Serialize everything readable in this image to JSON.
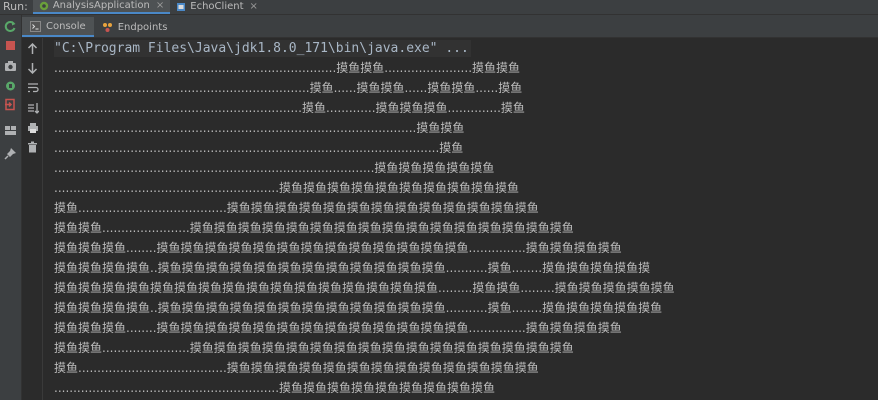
{
  "run_bar": {
    "label": "Run:",
    "tabs": [
      {
        "label": "AnalysisApplication",
        "active": true
      },
      {
        "label": "EchoClient",
        "active": false
      }
    ],
    "close_glyph": "×"
  },
  "console_tabs": [
    {
      "label": "Console",
      "icon": "console-icon",
      "active": true
    },
    {
      "label": "Endpoints",
      "icon": "endpoints-icon",
      "active": false
    }
  ],
  "left_toolbar": [
    "rerun-icon",
    "stop-icon",
    "camera-icon",
    "restart-debug-icon",
    "exit-icon",
    "layout-icon",
    "pin-icon"
  ],
  "console_toolbar": [
    "up-arrow-icon",
    "down-arrow-icon",
    "soft-wrap-icon",
    "sort-icon",
    "print-icon",
    "trash-icon"
  ],
  "colors": {
    "background": "#2b2b2b",
    "panel": "#3c3f41",
    "accent": "#4a88c7",
    "text": "#bbbbbb",
    "command_text": "#a9b7c6"
  },
  "console": {
    "command": "\"C:\\Program Files\\Java\\jdk1.8.0_171\\bin\\java.exe\" ...",
    "lines": [
      "..........................................................................摸鱼摸鱼.......................摸鱼摸鱼",
      "...................................................................摸鱼......摸鱼摸鱼......摸鱼摸鱼......摸鱼",
      ".................................................................摸鱼.............摸鱼摸鱼摸鱼..............摸鱼",
      "...............................................................................................摸鱼摸鱼",
      ".....................................................................................................摸鱼",
      "....................................................................................摸鱼摸鱼摸鱼摸鱼摸鱼",
      "...........................................................摸鱼摸鱼摸鱼摸鱼摸鱼摸鱼摸鱼摸鱼摸鱼摸鱼",
      "摸鱼.......................................摸鱼摸鱼摸鱼摸鱼摸鱼摸鱼摸鱼摸鱼摸鱼摸鱼摸鱼摸鱼摸鱼",
      "摸鱼摸鱼.......................摸鱼摸鱼摸鱼摸鱼摸鱼摸鱼摸鱼摸鱼摸鱼摸鱼摸鱼摸鱼摸鱼摸鱼摸鱼摸鱼",
      "摸鱼摸鱼摸鱼........摸鱼摸鱼摸鱼摸鱼摸鱼摸鱼摸鱼摸鱼摸鱼摸鱼摸鱼摸鱼摸鱼...............摸鱼摸鱼摸鱼摸鱼",
      "摸鱼摸鱼摸鱼摸鱼..摸鱼摸鱼摸鱼摸鱼摸鱼摸鱼摸鱼摸鱼摸鱼摸鱼摸鱼摸鱼...........摸鱼........摸鱼摸鱼摸鱼摸鱼摸",
      "摸鱼摸鱼摸鱼摸鱼摸鱼摸鱼摸鱼摸鱼摸鱼摸鱼摸鱼摸鱼摸鱼摸鱼摸鱼摸鱼.........摸鱼摸鱼.........摸鱼摸鱼摸鱼摸鱼摸鱼",
      "摸鱼摸鱼摸鱼摸鱼..摸鱼摸鱼摸鱼摸鱼摸鱼摸鱼摸鱼摸鱼摸鱼摸鱼摸鱼摸鱼...........摸鱼........摸鱼摸鱼摸鱼摸鱼摸鱼",
      "摸鱼摸鱼摸鱼........摸鱼摸鱼摸鱼摸鱼摸鱼摸鱼摸鱼摸鱼摸鱼摸鱼摸鱼摸鱼摸鱼...............摸鱼摸鱼摸鱼摸鱼",
      "摸鱼摸鱼.......................摸鱼摸鱼摸鱼摸鱼摸鱼摸鱼摸鱼摸鱼摸鱼摸鱼摸鱼摸鱼摸鱼摸鱼摸鱼摸鱼",
      "摸鱼.......................................摸鱼摸鱼摸鱼摸鱼摸鱼摸鱼摸鱼摸鱼摸鱼摸鱼摸鱼摸鱼摸鱼",
      "...........................................................摸鱼摸鱼摸鱼摸鱼摸鱼摸鱼摸鱼摸鱼摸鱼"
    ]
  }
}
